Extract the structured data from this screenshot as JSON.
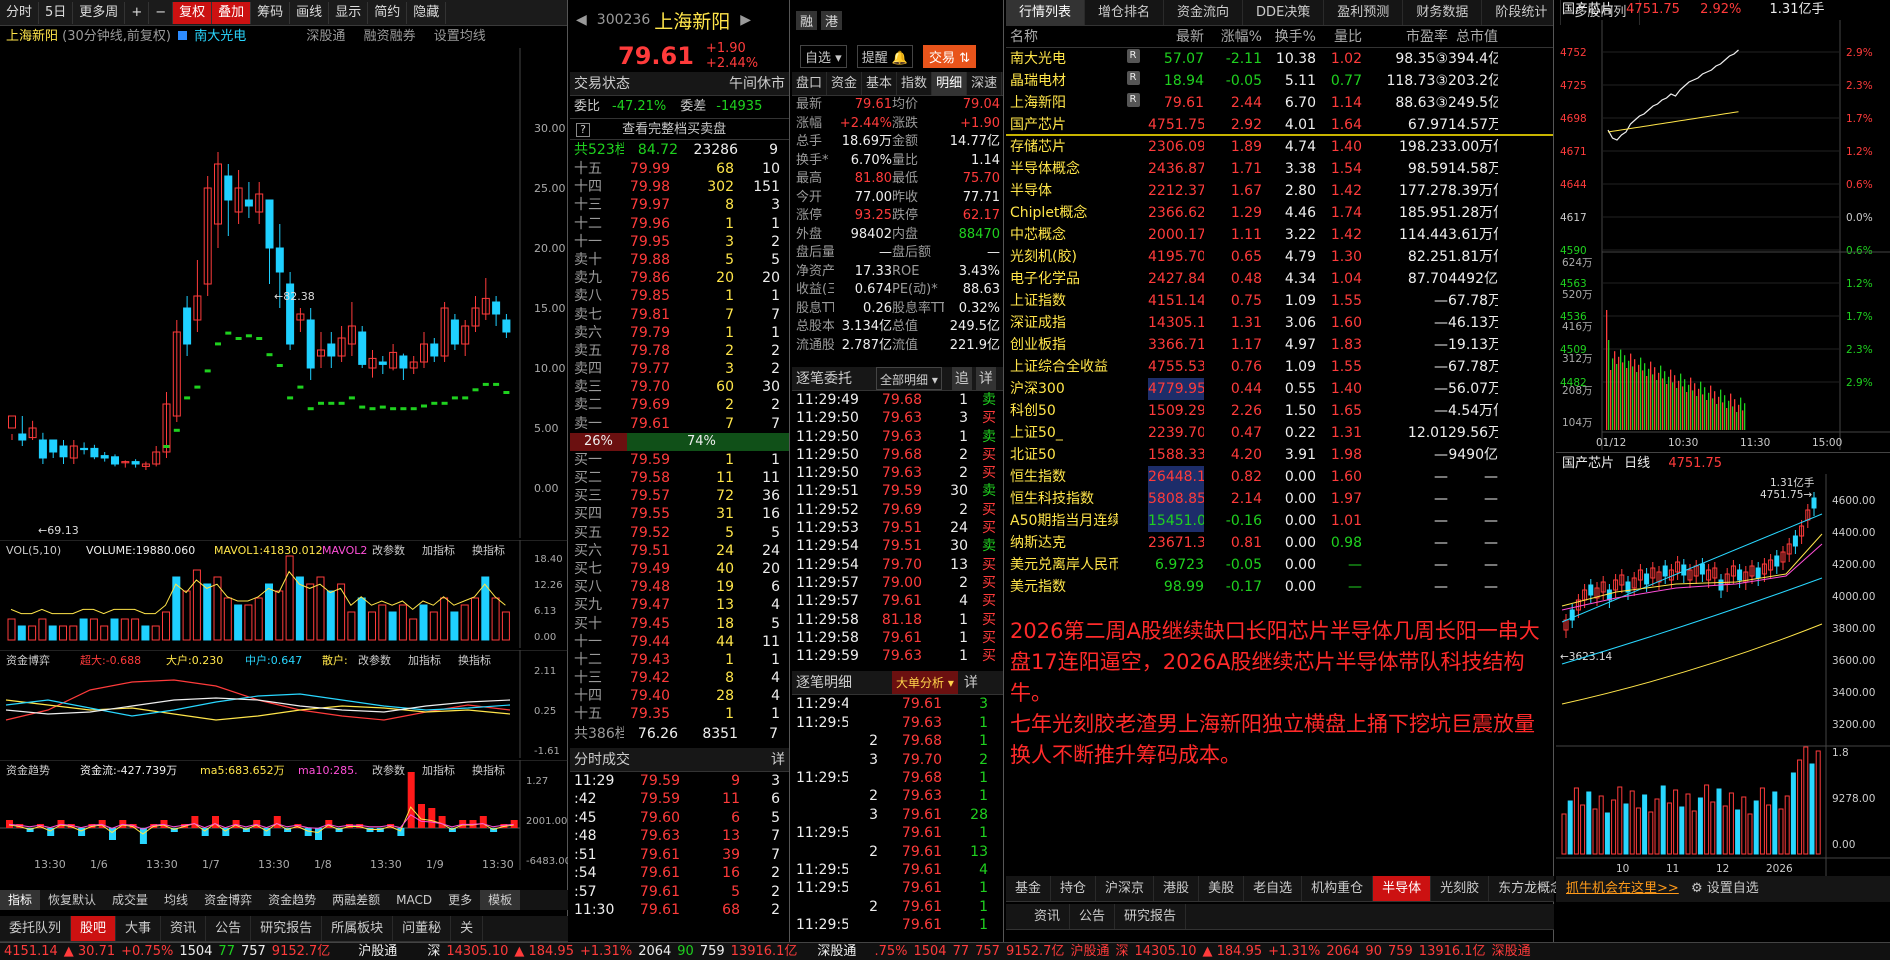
{
  "colors": {
    "up": "#ff3b3b",
    "down": "#1fd11f",
    "bg": "#000000",
    "accent": "#c11111"
  },
  "left": {
    "toolbar": [
      "分时",
      "5日",
      "更多周",
      "+",
      "−",
      "复权",
      "叠加",
      "筹码",
      "画线",
      "显示",
      "简约",
      "隐藏"
    ],
    "info": {
      "name": "上海新阳",
      "period": "(30分钟线,前复权)",
      "compare": "南大光电",
      "items": [
        "深股通",
        "融资融券",
        "设置均线"
      ]
    },
    "price_axis": [
      "30.00",
      "25.00",
      "20.00",
      "15.00",
      "10.00",
      "5.00",
      "0.00"
    ],
    "hi": "82.38",
    "lo": "69.13",
    "vol": {
      "label": "VOL(5,10)",
      "volume": "VOLUME:19880.060",
      "ma1": "MAVOL1:41830.012",
      "ma2": "MAVOL2",
      "actions": [
        "改参数",
        "加指标",
        "换指标"
      ],
      "axis": [
        "18.40",
        "12.26",
        "6.13",
        "0.00"
      ]
    },
    "fund": {
      "label": "资金博弈",
      "super": "超大:-0.688",
      "big": "大户:0.230",
      "mid": "中户:0.647",
      "small": "散户:",
      "actions": [
        "改参数",
        "加指标",
        "换指标"
      ],
      "axis": [
        "2.11",
        "0.25",
        "-1.61"
      ]
    },
    "trend": {
      "label": "资金趋势",
      "flow": "资金流:-427.739万",
      "ma5": "ma5:683.652万",
      "ma10": "ma10:285.",
      "actions": [
        "改参数",
        "加指标",
        "换指标"
      ],
      "axis": [
        "1.27",
        "2001.00",
        "-6483.00"
      ]
    },
    "dates": [
      "13:30",
      "1/6",
      "13:30",
      "1/7",
      "13:30",
      "1/8",
      "13:30",
      "1/9",
      "13:30"
    ],
    "ind_tabs": [
      "指标",
      "恢复默认",
      "成交量",
      "均线",
      "资金博弈",
      "资金趋势",
      "两融差额",
      "MACD",
      "更多",
      "模板"
    ],
    "bottom_tabs": [
      "委托队列",
      "股吧",
      "大事",
      "资讯",
      "公告",
      "研究报告",
      "所属板块",
      "问董秘",
      "关"
    ]
  },
  "mid": {
    "code": "300236",
    "name": "上海新阳",
    "price": "79.61",
    "chg": "+1.90",
    "pct": "+2.44%",
    "btns": [
      "融",
      "港"
    ],
    "sel": "自选",
    "remind": "提醒",
    "trade": "交易",
    "status_l": "交易状态",
    "status_r": "午间休市",
    "weibi": "委比",
    "weibi_v": "-47.21%",
    "weicha": "委差",
    "weicha_v": "-14935",
    "full": "查看完整档买卖盘",
    "sell_total": [
      "共523档",
      "84.72",
      "23286",
      "9"
    ],
    "sells": [
      [
        "十五",
        "79.99",
        "68",
        "10"
      ],
      [
        "十四",
        "79.98",
        "302",
        "151"
      ],
      [
        "十三",
        "79.97",
        "8",
        "3"
      ],
      [
        "十二",
        "79.96",
        "1",
        "1"
      ],
      [
        "十一",
        "79.95",
        "3",
        "2"
      ],
      [
        "卖十",
        "79.88",
        "5",
        "5"
      ],
      [
        "卖九",
        "79.86",
        "20",
        "20"
      ],
      [
        "卖八",
        "79.85",
        "1",
        "1"
      ],
      [
        "卖七",
        "79.81",
        "7",
        "7"
      ],
      [
        "卖六",
        "79.79",
        "1",
        "1"
      ],
      [
        "卖五",
        "79.78",
        "2",
        "2"
      ],
      [
        "卖四",
        "79.77",
        "3",
        "2"
      ],
      [
        "卖三",
        "79.70",
        "60",
        "30"
      ],
      [
        "卖二",
        "79.69",
        "2",
        "2"
      ],
      [
        "卖一",
        "79.61",
        "7",
        "7"
      ]
    ],
    "ratio_l": "26%",
    "ratio_r": "74%",
    "buys": [
      [
        "买一",
        "79.59",
        "1",
        "1"
      ],
      [
        "买二",
        "79.58",
        "11",
        "11"
      ],
      [
        "买三",
        "79.57",
        "72",
        "36"
      ],
      [
        "买四",
        "79.55",
        "31",
        "16"
      ],
      [
        "买五",
        "79.52",
        "5",
        "5"
      ],
      [
        "买六",
        "79.51",
        "24",
        "24"
      ],
      [
        "买七",
        "79.49",
        "40",
        "20"
      ],
      [
        "买八",
        "79.48",
        "19",
        "6"
      ],
      [
        "买九",
        "79.47",
        "13",
        "4"
      ],
      [
        "买十",
        "79.45",
        "18",
        "5"
      ],
      [
        "十一",
        "79.44",
        "44",
        "11"
      ],
      [
        "十二",
        "79.43",
        "1",
        "1"
      ],
      [
        "十三",
        "79.42",
        "8",
        "4"
      ],
      [
        "十四",
        "79.40",
        "28",
        "4"
      ],
      [
        "十五",
        "79.35",
        "1",
        "1"
      ]
    ],
    "buy_total": [
      "共386档",
      "76.26",
      "8351",
      "7"
    ],
    "fs_title": "分时成交",
    "fs_rows": [
      [
        "11:29",
        "79.59",
        "9",
        "3"
      ],
      [
        ":42",
        "79.59",
        "11",
        "6"
      ],
      [
        ":45",
        "79.60",
        "6",
        "5"
      ],
      [
        ":48",
        "79.63",
        "13",
        "7"
      ],
      [
        ":51",
        "79.61",
        "39",
        "7"
      ],
      [
        ":54",
        "79.61",
        "16",
        "2"
      ],
      [
        ":57",
        "79.61",
        "5",
        "2"
      ],
      [
        "11:30",
        "79.61",
        "68",
        "2"
      ]
    ]
  },
  "quote": {
    "tabs": [
      "盘口",
      "资金",
      "基本",
      "指数",
      "明细",
      "深速"
    ],
    "rows": [
      [
        "最新",
        "79.61",
        "均价",
        "79.04"
      ],
      [
        "涨幅",
        "+2.44%",
        "涨跌",
        "+1.90"
      ],
      [
        "总手",
        "18.69万",
        "金额",
        "14.77亿"
      ],
      [
        "换手*",
        "6.70%",
        "量比",
        "1.14"
      ],
      [
        "最高",
        "81.80",
        "最低",
        "75.70"
      ],
      [
        "今开",
        "77.00",
        "昨收",
        "77.71"
      ],
      [
        "涨停",
        "93.25",
        "跌停",
        "62.17"
      ],
      [
        "外盘",
        "98402",
        "内盘",
        "88470"
      ],
      [
        "盘后量",
        "—",
        "盘后额",
        "—"
      ],
      [
        "净资产",
        "17.33",
        "ROE",
        "3.43%"
      ],
      [
        "收益(三)",
        "0.674",
        "PE(动)*",
        "88.63"
      ],
      [
        "股息TTM",
        "0.26",
        "股息率TTM",
        "0.32%"
      ],
      [
        "总股本",
        "3.134亿",
        "总值",
        "249.5亿"
      ],
      [
        "流通股",
        "2.787亿",
        "流值",
        "221.9亿"
      ]
    ]
  },
  "zhubi": {
    "title": "逐笔委托",
    "filter": "全部明细",
    "btns": [
      "追",
      "详"
    ],
    "rows": [
      [
        "11:29:49",
        "79.68",
        "1",
        "卖"
      ],
      [
        "11:29:50",
        "79.63",
        "3",
        "买"
      ],
      [
        "11:29:50",
        "79.63",
        "1",
        "卖"
      ],
      [
        "11:29:50",
        "79.68",
        "2",
        "买"
      ],
      [
        "11:29:50",
        "79.63",
        "2",
        "买"
      ],
      [
        "11:29:51",
        "79.59",
        "30",
        "卖"
      ],
      [
        "11:29:52",
        "79.69",
        "2",
        "买"
      ],
      [
        "11:29:53",
        "79.51",
        "24",
        "买"
      ],
      [
        "11:29:54",
        "79.51",
        "30",
        "卖"
      ],
      [
        "11:29:54",
        "79.70",
        "13",
        "买"
      ],
      [
        "11:29:57",
        "79.00",
        "2",
        "买"
      ],
      [
        "11:29:57",
        "79.61",
        "4",
        "买"
      ],
      [
        "11:29:58",
        "81.18",
        "1",
        "买"
      ],
      [
        "11:29:58",
        "79.61",
        "1",
        "买"
      ],
      [
        "11:29:59",
        "79.63",
        "1",
        "买"
      ]
    ]
  },
  "mingxi": {
    "title": "逐笔明细",
    "btn": "大单分析",
    "detail": "详",
    "rows": [
      [
        "11:29:49",
        "",
        "79.61",
        "3"
      ],
      [
        "11:29:50",
        "",
        "79.63",
        "1"
      ],
      [
        "",
        "2",
        "79.68",
        "1"
      ],
      [
        "",
        "3",
        "79.70",
        "2"
      ],
      [
        "11:29:51",
        "",
        "79.68",
        "1"
      ],
      [
        "",
        "2",
        "79.63",
        "1"
      ],
      [
        "",
        "3",
        "79.61",
        "28"
      ],
      [
        "11:29:54",
        "",
        "79.61",
        "1"
      ],
      [
        "",
        "2",
        "79.61",
        "13"
      ],
      [
        "11:29:57",
        "",
        "79.61",
        "4"
      ],
      [
        "11:29:58",
        "",
        "79.61",
        "1"
      ],
      [
        "",
        "2",
        "79.61",
        "1"
      ],
      [
        "11:29:59",
        "",
        "79.61",
        "1"
      ]
    ]
  },
  "list": {
    "tabs": [
      "行情列表",
      "增仓排名",
      "资金流向",
      "DDE决策",
      "盈利预测",
      "财务数据",
      "阶段统计",
      "多股同列"
    ],
    "headers": [
      "名称",
      "",
      "最新",
      "涨幅%",
      "换手%",
      "量比",
      "市盈率",
      "总市值"
    ],
    "rows": [
      [
        "南大光电",
        "R",
        "57.07",
        "-2.11",
        "10.38",
        "1.02",
        "98.35③",
        "394.4亿"
      ],
      [
        "晶瑞电材",
        "R",
        "18.94",
        "-0.05",
        "5.11",
        "0.77",
        "118.73③",
        "203.2亿"
      ],
      [
        "上海新阳",
        "R",
        "79.61",
        "2.44",
        "6.70",
        "1.14",
        "88.63③",
        "249.5亿"
      ],
      [
        "国产芯片",
        "",
        "4751.75",
        "2.92",
        "4.01",
        "1.64",
        "67.97",
        "14.57万亿"
      ],
      [
        "存储芯片",
        "",
        "2306.09",
        "1.89",
        "4.74",
        "1.40",
        "198.23",
        "3.00万亿"
      ],
      [
        "半导体概念",
        "",
        "2436.87",
        "1.71",
        "3.38",
        "1.54",
        "98.59",
        "14.58万亿"
      ],
      [
        "半导体",
        "",
        "2212.37",
        "1.67",
        "2.80",
        "1.42",
        "177.27",
        "8.39万亿"
      ],
      [
        "Chiplet概念",
        "",
        "2366.62",
        "1.29",
        "4.46",
        "1.74",
        "185.95",
        "1.28万亿"
      ],
      [
        "中芯概念",
        "",
        "2000.17",
        "1.11",
        "3.22",
        "1.42",
        "114.44",
        "3.61万亿"
      ],
      [
        "光刻机(胶)",
        "",
        "4195.70",
        "0.65",
        "4.79",
        "1.30",
        "82.25",
        "1.81万亿"
      ],
      [
        "电子化学品",
        "",
        "2427.84",
        "0.48",
        "4.34",
        "1.04",
        "87.70",
        "4492亿"
      ],
      [
        "上证指数",
        "",
        "4151.14",
        "0.75",
        "1.09",
        "1.55",
        "—",
        "67.78万亿"
      ],
      [
        "深证成指",
        "",
        "14305.10",
        "1.31",
        "3.06",
        "1.60",
        "—",
        "46.13万亿"
      ],
      [
        "创业板指",
        "",
        "3366.71",
        "1.17",
        "4.97",
        "1.83",
        "—",
        "19.13万亿"
      ],
      [
        "上证综合全收益",
        "",
        "4755.53",
        "0.76",
        "1.09",
        "1.55",
        "—",
        "67.78万亿"
      ],
      [
        "沪深300",
        "",
        "4779.95",
        "0.44",
        "0.55",
        "1.40",
        "—",
        "56.07万亿"
      ],
      [
        "科创50",
        "",
        "1509.29",
        "2.26",
        "1.50",
        "1.65",
        "—",
        "4.54万亿"
      ],
      [
        "上证50_",
        "",
        "2239.70",
        "0.47",
        "0.22",
        "1.31",
        "12.01",
        "29.56万亿"
      ],
      [
        "北证50",
        "",
        "1588.33",
        "4.20",
        "3.91",
        "1.98",
        "—",
        "9490亿"
      ],
      [
        "恒生指数",
        "",
        "26448.13",
        "0.82",
        "0.00",
        "1.60",
        "—",
        "—"
      ],
      [
        "恒生科技指数",
        "",
        "5808.85",
        "2.14",
        "0.00",
        "1.97",
        "—",
        "—"
      ],
      [
        "A50期指当月连续",
        "",
        "15451.0",
        "-0.16",
        "0.00",
        "1.01",
        "—",
        "—"
      ],
      [
        "纳斯达克",
        "",
        "23671.35",
        "0.81",
        "0.00",
        "0.98",
        "—",
        "—"
      ],
      [
        "美元兑离岸人民币",
        "",
        "6.9723",
        "-0.05",
        "0.00",
        "—",
        "—",
        "—"
      ],
      [
        "美元指数",
        "",
        "98.99",
        "-0.17",
        "0.00",
        "—",
        "—",
        "—"
      ]
    ],
    "note1": "2026第二周A股继续缺口长阳芯片半导体几周长阳一串大盘17连阳逼空，2026A股继续芯片半导体带队科技结构牛。",
    "note2": "七年光刻胶老渣男上海新阳独立横盘上捅下挖坑巨震放量换人不断推升筹码成本。",
    "bottom_tabs": [
      "基金",
      "持仓",
      "沪深京",
      "港股",
      "美股",
      "老自选",
      "机构重仓",
      "半导体",
      "光刻胶",
      "东方龙概念",
      "更多",
      "+"
    ],
    "ad": "抓牛机会在这里>>",
    "settings": "设置自选"
  },
  "right": {
    "title": "国产芯片",
    "price": "4751.75",
    "pct": "2.92%",
    "amt": "1.31亿手",
    "laxis": [
      "4752",
      "4725",
      "4698",
      "4671",
      "4644",
      "4617",
      "4590",
      "4563",
      "4536",
      "4509",
      "4482"
    ],
    "raxis": [
      "2.9%",
      "2.3%",
      "1.7%",
      "1.2%",
      "0.6%",
      "0.0%",
      "0.6%",
      "1.2%",
      "1.7%",
      "2.3%",
      "2.9%"
    ],
    "vaxis": [
      "624万",
      "520万",
      "416万",
      "312万",
      "208万",
      "104万"
    ],
    "times": [
      "01/12",
      "10:30",
      "11:30",
      "15:00"
    ],
    "day_title": "国产芯片",
    "day_sub": "日线",
    "day_price": "4751.75",
    "day_axis": [
      "4600.00",
      "4400.00",
      "4200.00",
      "4000.00",
      "3800.00",
      "3600.00",
      "3400.00",
      "3200.00"
    ],
    "day_hi": "4751.75",
    "day_lo": "3623.14",
    "day_amt": "1.31亿手",
    "day_vaxis": [
      "1.8",
      "9278.00",
      "0.00"
    ],
    "months": [
      "10",
      "11",
      "12",
      "2026"
    ]
  },
  "status": {
    "left": [
      "4151.14",
      "▲ 30.71",
      "+0.75%",
      "1504",
      "77",
      "757",
      "9152.7亿"
    ],
    "hgt": "沪股通",
    "sz": [
      "深",
      "14305.10",
      "▲ 184.95",
      "+1.31%",
      "2064",
      "90",
      "759",
      "13916.1亿"
    ],
    "sgt": "深股通",
    "right": [
      ".75%",
      "1504",
      "77",
      "757",
      "9152.7亿",
      "沪股通",
      "深",
      "14305.10",
      "▲ 184.95",
      "+1.31%",
      "2064",
      "90",
      "759",
      "13916.1亿",
      "深股通"
    ]
  },
  "bottom_right": {
    "tabs": [
      "资讯",
      "公告",
      "研究报告"
    ]
  }
}
